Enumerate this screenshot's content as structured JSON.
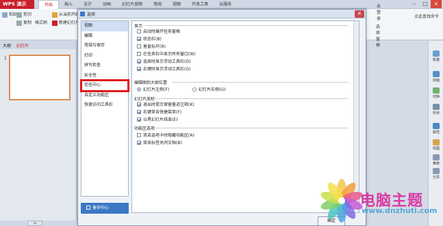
{
  "app": {
    "logo": "WPS 演示",
    "menu_tabs": [
      "开始",
      "插入",
      "设计",
      "动画",
      "幻灯片放映",
      "审阅",
      "视图",
      "开发工具",
      "云服务"
    ],
    "active_tab": "开始",
    "user": "未登录"
  },
  "ribbon": {
    "paste": "粘贴",
    "cut": "剪切",
    "copy": "复制",
    "format_painter": "格式刷",
    "from_current": "从当前开始",
    "new_slide": "新建幻灯片",
    "select_pane": "选择窗格",
    "find_cmd": "点此查找命令"
  },
  "left_pane": {
    "tabs": [
      "大纲",
      "幻灯片"
    ],
    "active_tab": "幻灯片",
    "slide_number": "1"
  },
  "right_pane": {
    "items": [
      "新建",
      "动画",
      "切换",
      "形状",
      "属性",
      "样图",
      "推荐",
      "分享"
    ]
  },
  "dialog": {
    "title": "选项",
    "nav_items": [
      "视图",
      "编辑",
      "常规与保存",
      "打印",
      "拼写检查",
      "安全性",
      "信任中心",
      "自定义功能区",
      "快速访问工具栏"
    ],
    "selected_item": "视图",
    "highlighted_item": "信任中心",
    "backup_button": "备份中心",
    "ok_button": "确定",
    "sections": {
      "display": {
        "title": "显示",
        "options": [
          {
            "label": "启动时展开任务窗格",
            "checked": false
          },
          {
            "label": "状态栏(B)",
            "checked": true
          },
          {
            "label": "垂直标尺(R)",
            "checked": false
          },
          {
            "label": "在任务栏中显示所有窗口(W)",
            "checked": false
          },
          {
            "label": "选择时显示浮动工具栏(D)",
            "checked": true
          },
          {
            "label": "右键时显示浮动工具栏(G)",
            "checked": true
          }
        ]
      },
      "thumbnail": {
        "title": "编辑图和大纲位置",
        "left_option": "幻灯片左侧(F)",
        "right_option": "幻灯片右侧(G)",
        "selected": "left"
      },
      "slideshow": {
        "title": "幻灯片放映",
        "options": [
          {
            "label": "退出时提示保留墨迹注释(K)",
            "checked": true
          },
          {
            "label": "右键单击快捷菜单(F)",
            "checked": true
          },
          {
            "label": "以黑幻灯片结束(E)",
            "checked": true
          }
        ]
      },
      "ribbon_options": {
        "title": "功能区选项",
        "options": [
          {
            "label": "双击选项卡时隐藏功能区(A)",
            "checked": false
          },
          {
            "label": "双击标签关闭文档(B)",
            "checked": true
          }
        ]
      }
    }
  },
  "watermark": {
    "title": "电脑主题",
    "url": "www.dnzhuti.com"
  },
  "colors": {
    "accent": "#c8202b",
    "highlight_box": "#e01818",
    "primary_button": "#3b78c4",
    "selection": "#cfe0f5"
  }
}
